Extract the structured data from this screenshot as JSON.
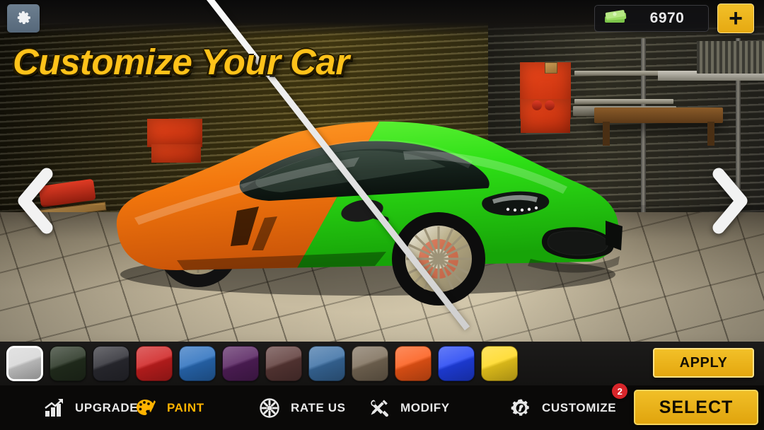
{
  "header": {
    "settings_icon": "gear-icon",
    "currency_icon": "money-stack-icon",
    "currency_amount": "6970",
    "add_currency_label": "+"
  },
  "title": "Customize Your Car",
  "nav_arrows": {
    "prev_icon": "chevron-left-icon",
    "next_icon": "chevron-right-icon"
  },
  "car_preview": {
    "left_half_color": "#f07a12",
    "right_half_color": "#2fe11a",
    "split_line_color": "#ffffff"
  },
  "palette": {
    "selected_index": 0,
    "swatches": [
      {
        "name": "white",
        "color": "#d6d6d6"
      },
      {
        "name": "dark-green",
        "color": "#24301f"
      },
      {
        "name": "dark-grey",
        "color": "#2c2c33"
      },
      {
        "name": "red",
        "color": "#cf2020"
      },
      {
        "name": "blue",
        "color": "#2a6fbe"
      },
      {
        "name": "purple",
        "color": "#55205e"
      },
      {
        "name": "maroon",
        "color": "#5d3a38"
      },
      {
        "name": "steel-blue",
        "color": "#3b6fa4"
      },
      {
        "name": "khaki-brown",
        "color": "#7c6d59"
      },
      {
        "name": "orange",
        "color": "#fb5a17"
      },
      {
        "name": "royal-blue",
        "color": "#2143f3"
      },
      {
        "name": "yellow",
        "color": "#ffd81e"
      }
    ]
  },
  "apply_button": {
    "label": "APPLY"
  },
  "select_button": {
    "label": "SELECT"
  },
  "bottom_nav": {
    "items": [
      {
        "label": "UPGRADE",
        "icon": "bar-chart-up-icon",
        "active": false,
        "badge": null
      },
      {
        "label": "PAINT",
        "icon": "paint-palette-icon",
        "active": true,
        "badge": null
      },
      {
        "label": "RATE US",
        "icon": "wheel-rim-icon",
        "active": false,
        "badge": null
      },
      {
        "label": "MODIFY",
        "icon": "tools-wrench-screwdriver-icon",
        "active": false,
        "badge": null
      },
      {
        "label": "CUSTOMIZE",
        "icon": "gear-wrench-icon",
        "active": false,
        "badge": "2"
      }
    ]
  },
  "colors": {
    "accent_yellow": "#f2c028",
    "badge_red": "#d8252a",
    "bar_black": "#0a0908",
    "title_yellow": "#ffc21a"
  }
}
